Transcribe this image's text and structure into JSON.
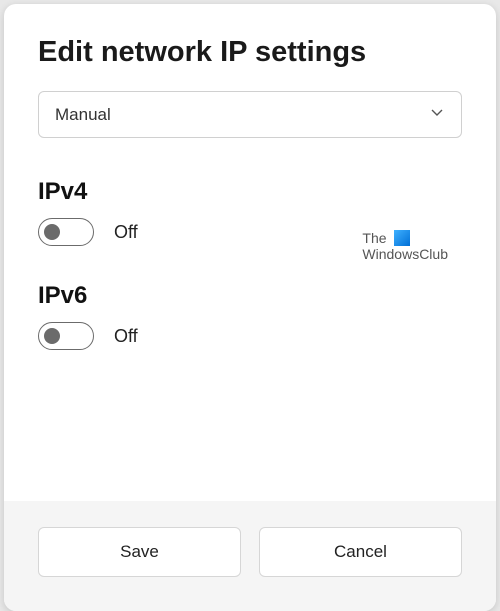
{
  "title": "Edit network IP settings",
  "mode_select": {
    "value": "Manual"
  },
  "ipv4": {
    "label": "IPv4",
    "state_label": "Off",
    "on": false
  },
  "ipv6": {
    "label": "IPv6",
    "state_label": "Off",
    "on": false
  },
  "watermark": {
    "line1": "The",
    "line2": "WindowsClub"
  },
  "buttons": {
    "save": "Save",
    "cancel": "Cancel"
  }
}
